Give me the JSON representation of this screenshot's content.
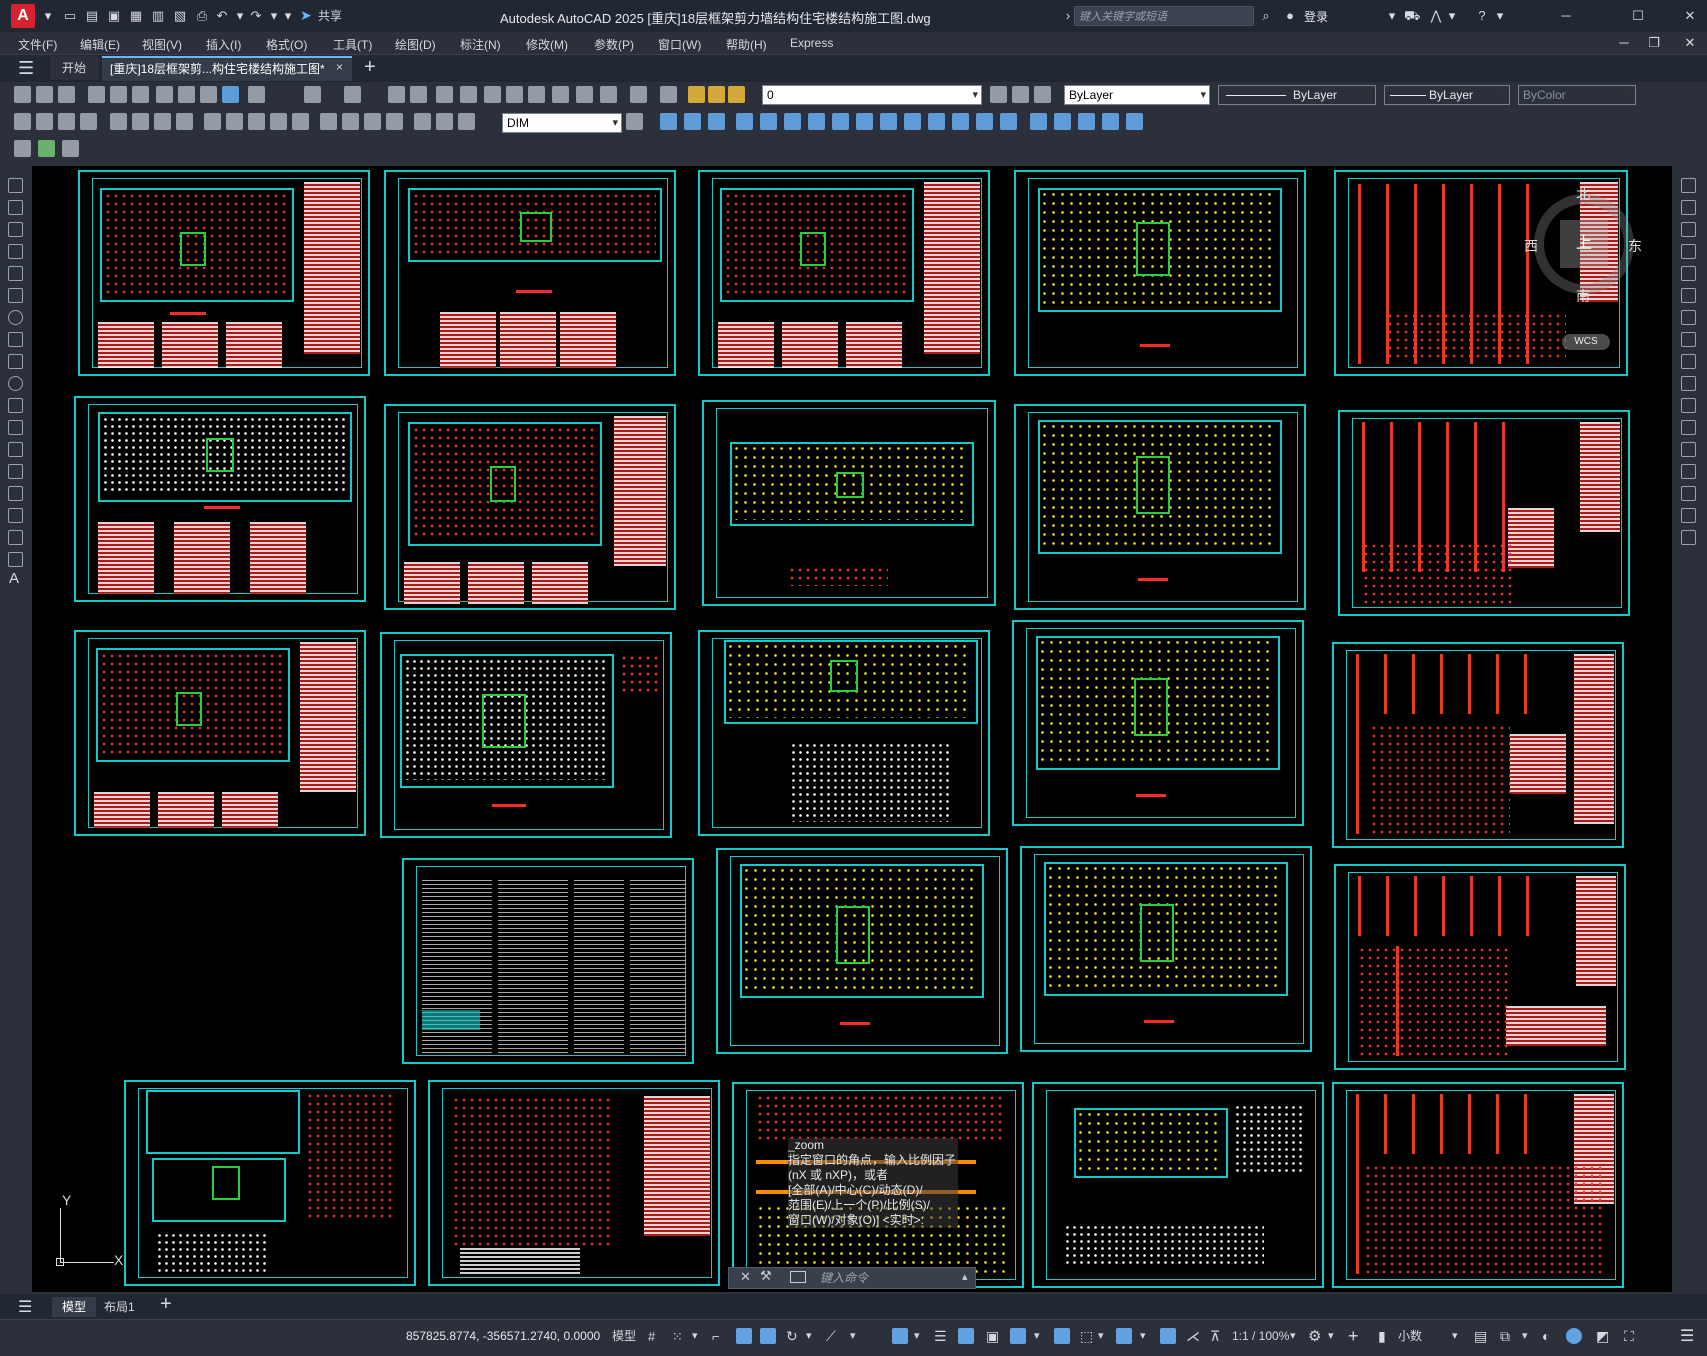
{
  "app": {
    "logo_letter": "A",
    "title": "Autodesk AutoCAD 2025    [重庆]18层框架剪力墙结构住宅楼结构施工图.dwg",
    "share_label": "共享",
    "search_placeholder": "键入关键字或短语",
    "login_label": "登录"
  },
  "menu": [
    "文件(F)",
    "编辑(E)",
    "视图(V)",
    "插入(I)",
    "格式(O)",
    "工具(T)",
    "绘图(D)",
    "标注(N)",
    "修改(M)",
    "参数(P)",
    "窗口(W)",
    "帮助(H)",
    "Express"
  ],
  "tabs": {
    "start": "开始",
    "document": "[重庆]18层框架剪...构住宅楼结构施工图*",
    "close": "×",
    "add": "+"
  },
  "toolbar": {
    "layer_value": "0",
    "color_value": "ByLayer",
    "linetype_value": "ByLayer",
    "lineweight_value": "ByLayer",
    "plotstyle_value": "ByColor",
    "dimstyle_value": "DIM"
  },
  "viewcube": {
    "north": "北",
    "south": "南",
    "east": "东",
    "west": "西",
    "face": "上",
    "wcs": "WCS"
  },
  "ucs": {
    "y_label": "Y",
    "x_label": "X"
  },
  "command": {
    "history": [
      "_zoom",
      "指定窗口的角点，输入比例因子",
      "(nX 或 nXP)，或者",
      "[全部(A)/中心(C)/动态(D)/",
      "范围(E)/上一个(P)/比例(S)/",
      "窗口(W)/对象(O)] <实时>:"
    ],
    "input_placeholder": "键入命令"
  },
  "layout_tabs": {
    "model": "模型",
    "layout1": "布局1",
    "add": "+"
  },
  "status": {
    "coordinates": "857825.8774, -356571.2740, 0.0000",
    "model_label": "模型",
    "scale_label": "1:1 / 100%",
    "units_label": "小数"
  },
  "colors": {
    "accent": "#6cb6ff",
    "sheet_border": "#14c9c9",
    "wall_green": "#27d03a",
    "logo_red": "#d6232f"
  }
}
